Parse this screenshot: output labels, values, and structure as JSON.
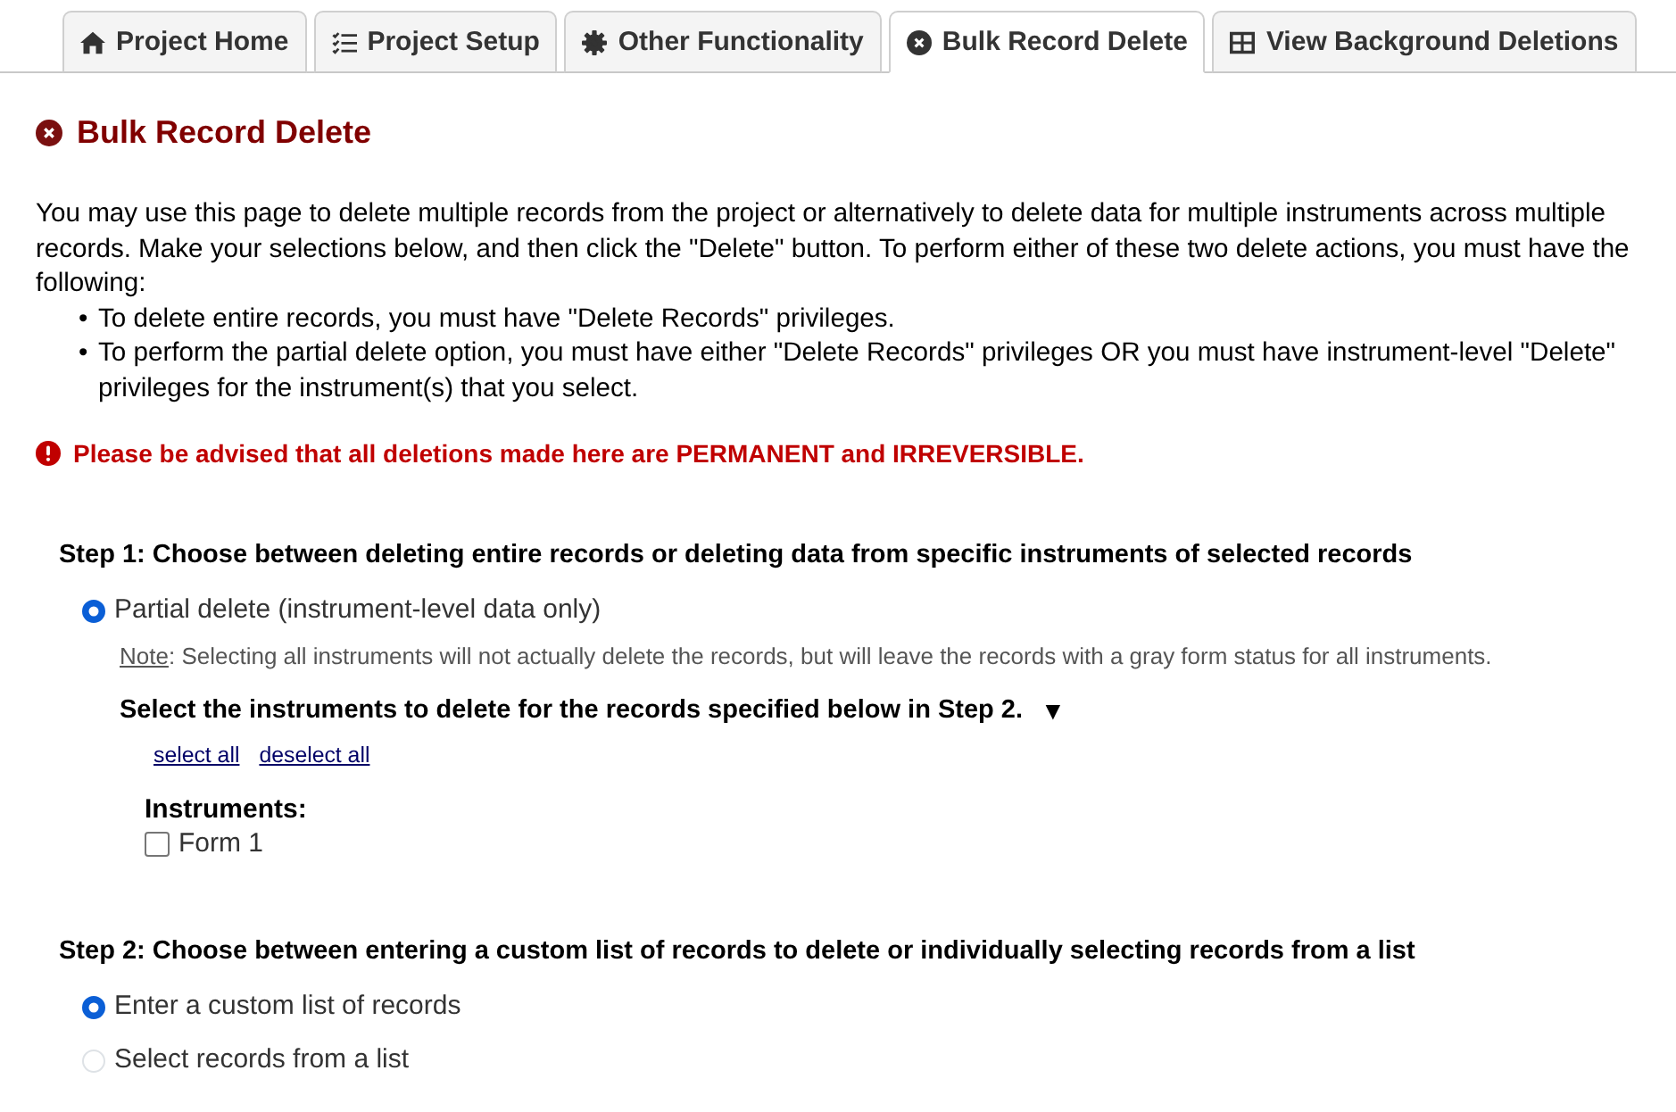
{
  "tabs": [
    {
      "label": "Project Home",
      "selected": false
    },
    {
      "label": "Project Setup",
      "selected": false
    },
    {
      "label": "Other Functionality",
      "selected": false
    },
    {
      "label": "Bulk Record Delete",
      "selected": true
    },
    {
      "label": "View Background Deletions",
      "selected": false
    }
  ],
  "page_title": "Bulk Record Delete",
  "intro": {
    "text": "You may use this page to delete multiple records from the project or alternatively to delete data for multiple instruments across multiple records. Make your selections below, and then click the \"Delete\" button. To perform either of these two delete actions, you must have the following:",
    "bullets": [
      {
        "marker": "•",
        "text": "To delete entire records, you must have \"Delete Records\" privileges."
      },
      {
        "marker": "•",
        "text": "To perform the partial delete option, you must have either \"Delete Records\" privileges OR you must have instrument-level \"Delete\" privileges for the instrument(s) that you select."
      }
    ]
  },
  "warning": "Please be advised that all deletions made here are PERMANENT and IRREVERSIBLE.",
  "step1": {
    "heading": "Step 1: Choose between deleting entire records or deleting data from specific instruments of selected records",
    "options": [
      {
        "label": "Partial delete (instrument-level data only)",
        "selected": true
      }
    ],
    "note_label": "Note",
    "note_text": ": Selecting all instruments will not actually delete the records, but will leave the records with a gray form status for all instruments.",
    "instruments_heading": "Select the instruments to delete for the records specified below in Step 2.",
    "toggle": "▼",
    "links": [
      "select all",
      "deselect all"
    ],
    "instruments_label": "Instruments:",
    "instruments": [
      {
        "label": "Form 1",
        "checked": false
      }
    ]
  },
  "step2": {
    "heading": "Step 2: Choose between entering a custom list of records to delete or individually selecting records from a list",
    "options": [
      {
        "label": "Enter a custom list of records",
        "selected": true
      },
      {
        "label": "Select records from a list",
        "selected": false
      }
    ]
  }
}
